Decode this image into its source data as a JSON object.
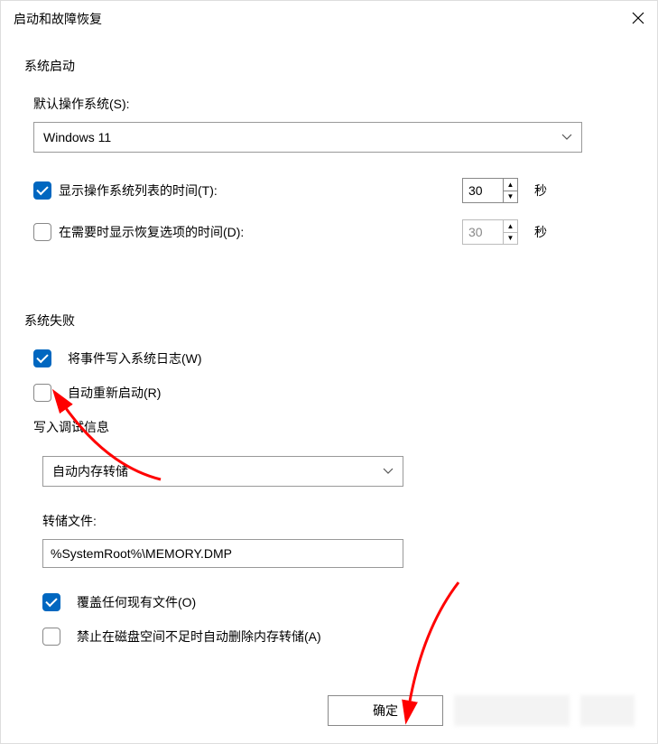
{
  "titlebar": {
    "title": "启动和故障恢复"
  },
  "startup": {
    "section_label": "系统启动",
    "default_os_label": "默认操作系统(S):",
    "default_os_value": "Windows 11",
    "show_os_list_label": "显示操作系统列表的时间(T):",
    "show_os_list_checked": true,
    "show_os_list_value": "30",
    "show_recovery_label": "在需要时显示恢复选项的时间(D):",
    "show_recovery_checked": false,
    "show_recovery_value": "30",
    "seconds_unit": "秒"
  },
  "failure": {
    "section_label": "系统失败",
    "write_event_label": "将事件写入系统日志(W)",
    "write_event_checked": true,
    "auto_restart_label": "自动重新启动(R)",
    "auto_restart_checked": false,
    "debug_info_label": "写入调试信息",
    "debug_info_value": "自动内存转储",
    "dump_file_label": "转储文件:",
    "dump_file_value": "%SystemRoot%\\MEMORY.DMP",
    "overwrite_label": "覆盖任何现有文件(O)",
    "overwrite_checked": true,
    "disable_auto_delete_label": "禁止在磁盘空间不足时自动删除内存转储(A)",
    "disable_auto_delete_checked": false
  },
  "buttons": {
    "ok": "确定"
  }
}
